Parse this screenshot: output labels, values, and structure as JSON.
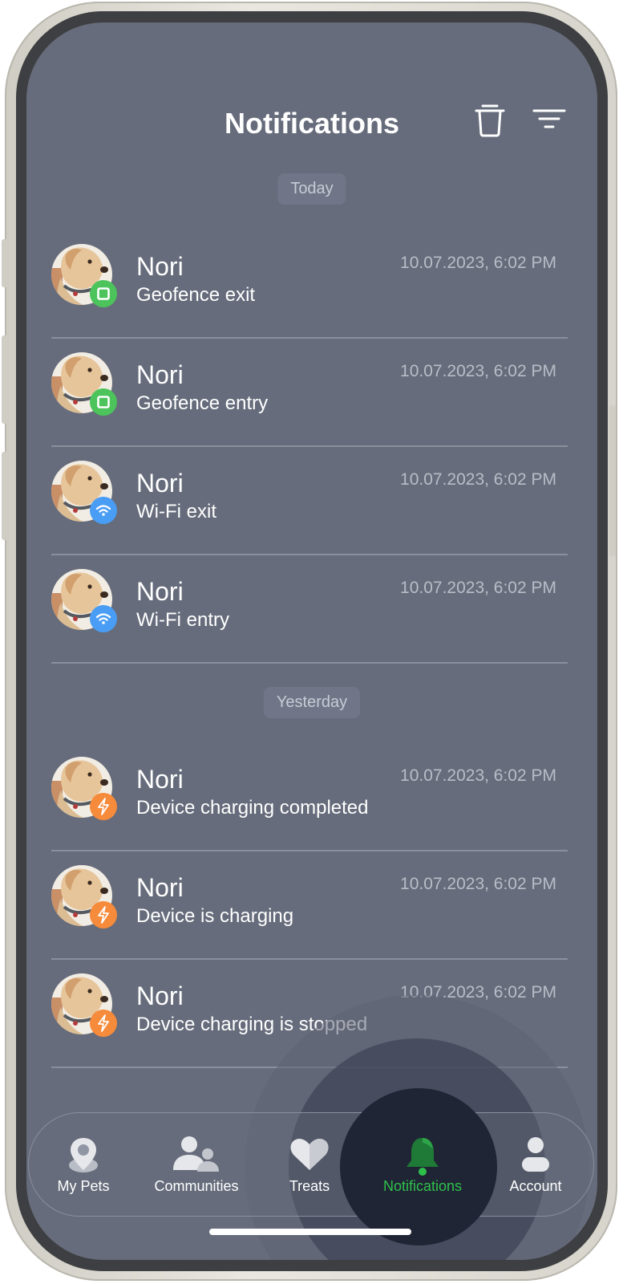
{
  "header": {
    "title": "Notifications"
  },
  "sections": [
    {
      "label": "Today",
      "items": [
        {
          "name": "Nori",
          "message": "Geofence exit",
          "time": "10.07.2023, 6:02 PM",
          "badge_icon": "geofence-icon",
          "badge_color": "#4cc35b"
        },
        {
          "name": "Nori",
          "message": "Geofence entry",
          "time": "10.07.2023, 6:02 PM",
          "badge_icon": "geofence-icon",
          "badge_color": "#4cc35b"
        },
        {
          "name": "Nori",
          "message": "Wi-Fi exit",
          "time": "10.07.2023, 6:02 PM",
          "badge_icon": "wifi-icon",
          "badge_color": "#4a9df4"
        },
        {
          "name": "Nori",
          "message": "Wi-Fi entry",
          "time": "10.07.2023, 6:02 PM",
          "badge_icon": "wifi-icon",
          "badge_color": "#4a9df4"
        }
      ]
    },
    {
      "label": "Yesterday",
      "items": [
        {
          "name": "Nori",
          "message": "Device charging completed",
          "time": "10.07.2023, 6:02 PM",
          "badge_icon": "charging-icon",
          "badge_color": "#f58b3b"
        },
        {
          "name": "Nori",
          "message": "Device is charging",
          "time": "10.07.2023, 6:02 PM",
          "badge_icon": "charging-icon",
          "badge_color": "#f58b3b"
        },
        {
          "name": "Nori",
          "message": "Device charging is stopped",
          "time": "10.07.2023, 6:02 PM",
          "badge_icon": "charging-icon",
          "badge_color": "#f58b3b"
        }
      ]
    }
  ],
  "tabs": [
    {
      "label": "My Pets",
      "icon": "location-pin-icon",
      "active": false
    },
    {
      "label": "Communities",
      "icon": "people-icon",
      "active": false
    },
    {
      "label": "Treats",
      "icon": "heart-icon",
      "active": false
    },
    {
      "label": "Notifications",
      "icon": "bell-icon",
      "active": true
    },
    {
      "label": "Account",
      "icon": "person-icon",
      "active": false
    }
  ],
  "colors": {
    "screen_bg": "#666c7b",
    "active_tab": "#2fc04b",
    "active_tab_bg": "#1f2534"
  }
}
